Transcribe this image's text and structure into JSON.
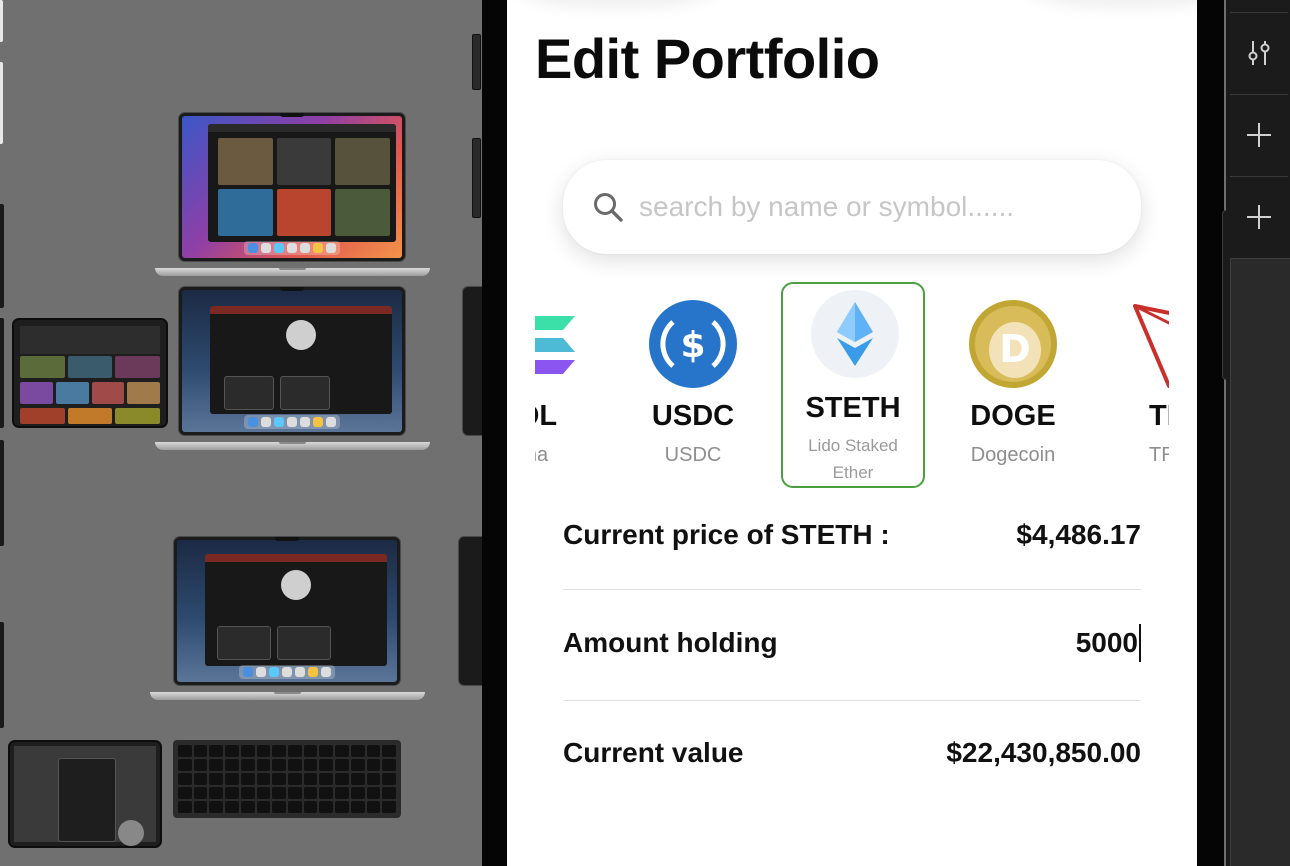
{
  "page": {
    "title": "Edit Portfolio"
  },
  "search": {
    "placeholder": "search by name or symbol......",
    "value": ""
  },
  "coins": [
    {
      "symbol": "SOL",
      "visible_symbol": "OL",
      "name": "Solana",
      "visible_name": "na",
      "selected": false
    },
    {
      "symbol": "USDC",
      "visible_symbol": "USDC",
      "name": "USDC",
      "visible_name": "USDC",
      "selected": false
    },
    {
      "symbol": "STETH",
      "visible_symbol": "STETH",
      "name": "Lido Staked Ether",
      "visible_name": "Lido Staked Ether",
      "selected": true
    },
    {
      "symbol": "DOGE",
      "visible_symbol": "DOGE",
      "name": "Dogecoin",
      "visible_name": "Dogecoin",
      "selected": false
    },
    {
      "symbol": "TRX",
      "visible_symbol": "TR",
      "name": "TRON",
      "visible_name": "TRO",
      "selected": false
    }
  ],
  "details": {
    "price_label": "Current price of STETH :",
    "price_value": "$4,486.17",
    "amount_label": "Amount holding",
    "amount_value": "5000",
    "value_label": "Current value",
    "value_value": "$22,430,850.00"
  },
  "colors": {
    "selected_border": "#4aa03f",
    "usdc_blue": "#2775ca",
    "eth_blue": "#3b9ef0",
    "doge_gold": "#c2a633",
    "tron_red": "#c9302c"
  },
  "toolbar": {
    "icons": [
      "sliders-icon",
      "plus-icon",
      "plus-icon"
    ]
  }
}
